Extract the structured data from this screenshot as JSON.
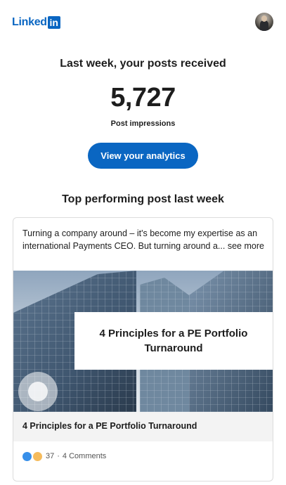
{
  "header": {
    "logo_word": "Linked",
    "logo_box": "in"
  },
  "summary": {
    "headline": "Last week, your posts received",
    "impressions": "5,727",
    "impressions_label": "Post impressions",
    "cta_label": "View your analytics"
  },
  "top_post": {
    "section_title": "Top performing post last week",
    "text": "Turning a company around – it's become my expertise as an international Payments CEO. But turning around a... see more",
    "image_overlay_title": "4 Principles for a PE Portfolio Turnaround",
    "article_title": "4 Principles for a PE Portfolio Turnaround",
    "reaction_count": "37",
    "separator": "·",
    "comments": "4 Comments"
  },
  "colors": {
    "brand": "#0a66c2",
    "like": "#378fe9",
    "insightful": "#f5bb5c"
  },
  "icons": [
    "linkedin-logo-icon",
    "avatar",
    "like-reaction-icon",
    "insightful-reaction-icon"
  ]
}
